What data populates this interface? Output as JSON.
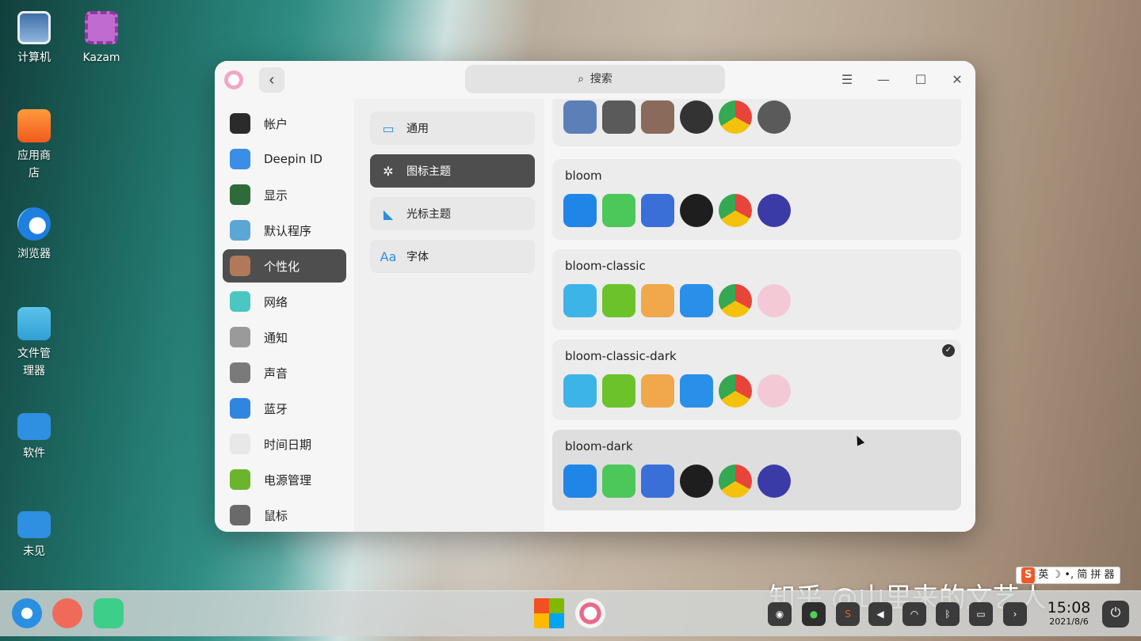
{
  "desktop": {
    "icons": [
      {
        "label": "计算机",
        "icon": "computer-icon"
      },
      {
        "label": "Kazam",
        "icon": "kazam-icon"
      },
      {
        "label": "应用商\n店",
        "icon": "app-store-icon"
      },
      {
        "label": "浏览器",
        "icon": "browser-icon"
      },
      {
        "label": "文件管\n理器",
        "icon": "file-manager-icon"
      },
      {
        "label": "软件",
        "icon": "folder-icon"
      },
      {
        "label": "未见",
        "icon": "folder-icon"
      }
    ]
  },
  "window": {
    "search_placeholder": "搜索",
    "sidebar": [
      {
        "label": "帐户",
        "icon": "account-icon",
        "color": "#2b2b2b"
      },
      {
        "label": "Deepin ID",
        "icon": "cloud-icon",
        "color": "#3a8ee6"
      },
      {
        "label": "显示",
        "icon": "display-icon",
        "color": "#2d6b3a"
      },
      {
        "label": "默认程序",
        "icon": "default-apps-icon",
        "color": "#5aa7d6"
      },
      {
        "label": "个性化",
        "icon": "personalization-icon",
        "color": "#b07a5a"
      },
      {
        "label": "网络",
        "icon": "network-icon",
        "color": "#4cc6c2"
      },
      {
        "label": "通知",
        "icon": "bell-icon",
        "color": "#9a9a9a"
      },
      {
        "label": "声音",
        "icon": "speaker-icon",
        "color": "#7a7a7a"
      },
      {
        "label": "蓝牙",
        "icon": "bluetooth-icon",
        "color": "#2f86e0"
      },
      {
        "label": "时间日期",
        "icon": "clock-icon",
        "color": "#e8e8e8"
      },
      {
        "label": "电源管理",
        "icon": "battery-icon",
        "color": "#6ab52c"
      },
      {
        "label": "鼠标",
        "icon": "mouse-icon",
        "color": "#6a6a6a"
      }
    ],
    "sidebar_active": 4,
    "subnav": [
      {
        "label": "通用",
        "glyph": "▭"
      },
      {
        "label": "图标主题",
        "glyph": "✲"
      },
      {
        "label": "光标主题",
        "glyph": "◣"
      },
      {
        "label": "字体",
        "glyph": "Aa"
      }
    ],
    "subnav_active": 1,
    "themes": [
      {
        "name": "",
        "partial": true,
        "selected": false,
        "icons": [
          "#5d7fb8",
          "#5a5a5a",
          "#8a6a5a",
          "#333333",
          "#e9b92a",
          "#5a5a5a"
        ]
      },
      {
        "name": "bloom",
        "selected": false,
        "icons": [
          "#1f86e8",
          "#4cc75a",
          "#3a6fd8",
          "#1e1e1e",
          "#e8443a",
          "#3b3ba8"
        ]
      },
      {
        "name": "bloom-classic",
        "selected": false,
        "icons": [
          "#3db4e8",
          "#6ac32a",
          "#f0a84a",
          "#2a8fe8",
          "#e8443a",
          "#f3c9d6"
        ]
      },
      {
        "name": "bloom-classic-dark",
        "selected": true,
        "icons": [
          "#3db4e8",
          "#6ac32a",
          "#f0a84a",
          "#2a8fe8",
          "#e8443a",
          "#f3c9d6"
        ]
      },
      {
        "name": "bloom-dark",
        "selected": false,
        "icons": [
          "#1f86e8",
          "#4cc75a",
          "#3a6fd8",
          "#1e1e1e",
          "#e8443a",
          "#3b3ba8"
        ]
      }
    ]
  },
  "taskbar": {
    "time": "15:08",
    "date": "2021/8/6"
  },
  "watermark": "知乎 @山里来的文艺人",
  "ime": {
    "logo": "S",
    "text": "英 ☽ •, 简 拼 器"
  }
}
